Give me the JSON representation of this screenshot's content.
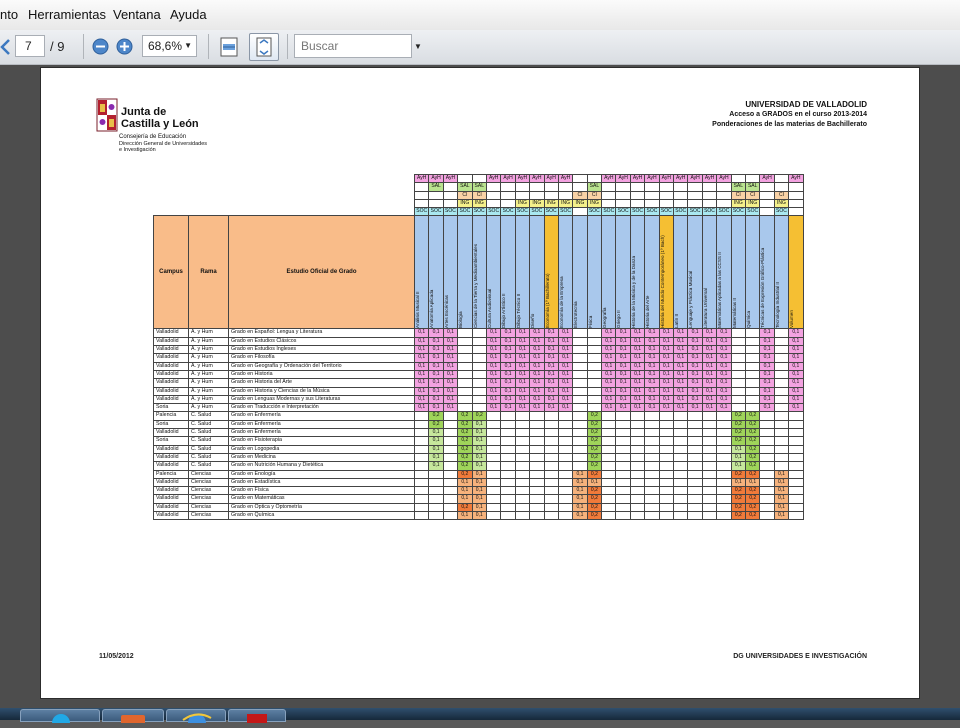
{
  "viewer": {
    "menu": [
      "nto",
      "Herramientas",
      "Ventana",
      "Ayuda"
    ],
    "current_page": "7",
    "total_pages": "/ 9",
    "zoom": "68,6%",
    "search_placeholder": "Buscar"
  },
  "doc": {
    "logo_line1": "Junta de",
    "logo_line2": "Castilla y León",
    "consejeria": "Consejería de Educación",
    "direccion1": "Dirección General de Universidades",
    "direccion2": "e Investigación",
    "university": "UNIVERSIDAD DE VALLADOLID",
    "subtitle": "Acceso a GRADOS en el curso 2013-2014",
    "subtitle2": "Ponderaciones de las materias de Bachillerato",
    "footer_date": "11/05/2012",
    "footer_dept": "DG UNIVERSIDADES E INVESTIGACIÓN"
  },
  "table": {
    "head_campus": "Campus",
    "head_rama": "Rama",
    "head_estudio": "Estudio Oficial de Grado",
    "subjects": [
      "Análisis Musical II",
      "Anatomía Aplicada",
      "Artes Escénicas",
      "Biología",
      "Ciencias de la Tierra y Medioambientales",
      "Cultura Audiovisual",
      "Dibujo Artístico II",
      "Dibujo Técnico II",
      "Diseño",
      "Economía (1º Bachillerato)",
      "Economía de la Empresa",
      "Electrotecnia",
      "Física",
      "Geografía",
      "Griego II",
      "Historia de la Música y de la Danza",
      "Historia del Arte",
      "Historia del Mundo Contemporáneo (1º Bach)",
      "Latín II",
      "Lenguaje y Práctica Musical",
      "Literatura Universal",
      "Matemáticas Aplicadas a las CCSS II",
      "Matemáticas II",
      "Química",
      "Técnicas de Expresión Gráfico-Plástica",
      "Tecnología Industrial II",
      "Volumen"
    ],
    "subject_colors": [
      "#a9c8ec",
      "#a9c8ec",
      "#a9c8ec",
      "#a9c8ec",
      "#a9c8ec",
      "#a9c8ec",
      "#a9c8ec",
      "#a9c8ec",
      "#a9c8ec",
      "#f5bf33",
      "#a9c8ec",
      "#a9c8ec",
      "#a9c8ec",
      "#a9c8ec",
      "#a9c8ec",
      "#a9c8ec",
      "#a9c8ec",
      "#f5bf33",
      "#a9c8ec",
      "#a9c8ec",
      "#a9c8ec",
      "#a9c8ec",
      "#a9c8ec",
      "#a9c8ec",
      "#a9c8ec",
      "#a9c8ec",
      "#f5bf33"
    ],
    "code_rows": [
      [
        "AyH",
        "AyH",
        "AyH",
        "",
        "",
        "AyH",
        "AyH",
        "AyH",
        "AyH",
        "AyH",
        "AyH",
        "",
        "",
        "AyH",
        "AyH",
        "AyH",
        "AyH",
        "AyH",
        "AyH",
        "AyH",
        "AyH",
        "AyH",
        "",
        "",
        "AyH",
        "",
        "AyH"
      ],
      [
        "",
        "SAL",
        "",
        "SAL",
        "SAL",
        "",
        "",
        "",
        "",
        "",
        "",
        "",
        "SAL",
        "",
        "",
        "",
        "",
        "",
        "",
        "",
        "",
        "",
        "SAL",
        "SAL",
        "",
        "",
        ""
      ],
      [
        "",
        "",
        "",
        "CI",
        "CI",
        "",
        "",
        "",
        "",
        "",
        "",
        "CI",
        "CI",
        "",
        "",
        "",
        "",
        "",
        "",
        "",
        "",
        "",
        "CI",
        "CI",
        "",
        "CI",
        ""
      ],
      [
        "",
        "",
        "",
        "ING",
        "ING",
        "",
        "",
        "ING",
        "ING",
        "ING",
        "ING",
        "ING",
        "ING",
        "",
        "",
        "",
        "",
        "",
        "",
        "",
        "",
        "",
        "ING",
        "ING",
        "",
        "ING",
        ""
      ],
      [
        "SOC",
        "SOC",
        "SOC",
        "SOC",
        "SOC",
        "SOC",
        "SOC",
        "SOC",
        "SOC",
        "SOC",
        "SOC",
        "",
        "SOC",
        "SOC",
        "SOC",
        "SOC",
        "SOC",
        "SOC",
        "SOC",
        "SOC",
        "SOC",
        "SOC",
        "SOC",
        "SOC",
        "",
        "SOC",
        ""
      ]
    ],
    "code_colors": {
      "AyH": "#f3a2e0",
      "SAL": "#b9e38f",
      "CI": "#f9d2a6",
      "ING": "#f4f08a",
      "SOC": "#a9e8f0"
    },
    "value_colors": {
      "pink": "#f3a2e0",
      "green": "#9fd45a",
      "orange": "#f07a3a",
      "plain": "#ffffff"
    },
    "rows": [
      {
        "campus": "Valladolid",
        "rama": "A. y Hum",
        "estudio": "Grado en Español: Lengua y Literatura",
        "v": [
          "0,1",
          "0,1",
          "0,1",
          "",
          "",
          "0,1",
          "0,1",
          "0,1",
          "0,1",
          "0,1",
          "0,1",
          "",
          "",
          "0,1",
          "0,1",
          "0,1",
          "0,1",
          "0,1",
          "0,1",
          "0,1",
          "0,1",
          "0,1",
          "",
          "",
          "0,1",
          "",
          "0,1"
        ],
        "c": "pink"
      },
      {
        "campus": "Valladolid",
        "rama": "A. y Hum",
        "estudio": "Grado en Estudios Clásicos",
        "v": [
          "0,1",
          "0,1",
          "0,1",
          "",
          "",
          "0,1",
          "0,1",
          "0,1",
          "0,1",
          "0,1",
          "0,1",
          "",
          "",
          "0,1",
          "0,1",
          "0,1",
          "0,1",
          "0,1",
          "0,1",
          "0,1",
          "0,1",
          "0,1",
          "",
          "",
          "0,1",
          "",
          "0,1"
        ],
        "c": "pink"
      },
      {
        "campus": "Valladolid",
        "rama": "A. y Hum",
        "estudio": "Grado en Estudios Ingleses",
        "v": [
          "0,1",
          "0,1",
          "0,1",
          "",
          "",
          "0,1",
          "0,1",
          "0,1",
          "0,1",
          "0,1",
          "0,1",
          "",
          "",
          "0,1",
          "0,1",
          "0,1",
          "0,1",
          "0,1",
          "0,1",
          "0,1",
          "0,1",
          "0,1",
          "",
          "",
          "0,1",
          "",
          "0,1"
        ],
        "c": "pink"
      },
      {
        "campus": "Valladolid",
        "rama": "A. y Hum",
        "estudio": "Grado en Filosofía",
        "v": [
          "0,1",
          "0,1",
          "0,1",
          "",
          "",
          "0,1",
          "0,1",
          "0,1",
          "0,1",
          "0,1",
          "0,1",
          "",
          "",
          "0,1",
          "0,1",
          "0,1",
          "0,1",
          "0,1",
          "0,1",
          "0,1",
          "0,1",
          "0,1",
          "",
          "",
          "0,1",
          "",
          "0,1"
        ],
        "c": "pink"
      },
      {
        "campus": "Valladolid",
        "rama": "A. y Hum",
        "estudio": "Grado en Geografía y Ordenación del Territorio",
        "v": [
          "0,1",
          "0,1",
          "0,1",
          "",
          "",
          "0,1",
          "0,1",
          "0,1",
          "0,1",
          "0,1",
          "0,1",
          "",
          "",
          "0,1",
          "0,1",
          "0,1",
          "0,1",
          "0,1",
          "0,1",
          "0,1",
          "0,1",
          "0,1",
          "",
          "",
          "0,1",
          "",
          "0,1"
        ],
        "c": "pink"
      },
      {
        "campus": "Valladolid",
        "rama": "A. y Hum",
        "estudio": "Grado en Historia",
        "v": [
          "0,1",
          "0,1",
          "0,1",
          "",
          "",
          "0,1",
          "0,1",
          "0,1",
          "0,1",
          "0,1",
          "0,1",
          "",
          "",
          "0,1",
          "0,1",
          "0,1",
          "0,1",
          "0,1",
          "0,1",
          "0,1",
          "0,1",
          "0,1",
          "",
          "",
          "0,1",
          "",
          "0,1"
        ],
        "c": "pink"
      },
      {
        "campus": "Valladolid",
        "rama": "A. y Hum",
        "estudio": "Grado en Historia del Arte",
        "v": [
          "0,1",
          "0,1",
          "0,1",
          "",
          "",
          "0,1",
          "0,1",
          "0,1",
          "0,1",
          "0,1",
          "0,1",
          "",
          "",
          "0,1",
          "0,1",
          "0,1",
          "0,1",
          "0,1",
          "0,1",
          "0,1",
          "0,1",
          "0,1",
          "",
          "",
          "0,1",
          "",
          "0,1"
        ],
        "c": "pink"
      },
      {
        "campus": "Valladolid",
        "rama": "A. y Hum",
        "estudio": "Grado en Historia y Ciencias de la Música",
        "v": [
          "0,1",
          "0,1",
          "0,1",
          "",
          "",
          "0,1",
          "0,1",
          "0,1",
          "0,1",
          "0,1",
          "0,1",
          "",
          "",
          "0,1",
          "0,1",
          "0,1",
          "0,1",
          "0,1",
          "0,1",
          "0,1",
          "0,1",
          "0,1",
          "",
          "",
          "0,1",
          "",
          "0,1"
        ],
        "c": "pink"
      },
      {
        "campus": "Valladolid",
        "rama": "A. y Hum",
        "estudio": "Grado en Lenguas Modernas y sus Literaturas",
        "v": [
          "0,1",
          "0,1",
          "0,1",
          "",
          "",
          "0,1",
          "0,1",
          "0,1",
          "0,1",
          "0,1",
          "0,1",
          "",
          "",
          "0,1",
          "0,1",
          "0,1",
          "0,1",
          "0,1",
          "0,1",
          "0,1",
          "0,1",
          "0,1",
          "",
          "",
          "0,1",
          "",
          "0,1"
        ],
        "c": "pink"
      },
      {
        "campus": "Soria",
        "rama": "A. y Hum",
        "estudio": "Grado en Traducción e Interpretación",
        "v": [
          "0,1",
          "0,1",
          "0,1",
          "",
          "",
          "0,1",
          "0,1",
          "0,1",
          "0,1",
          "0,1",
          "0,1",
          "",
          "",
          "0,1",
          "0,1",
          "0,1",
          "0,1",
          "0,1",
          "0,1",
          "0,1",
          "0,1",
          "0,1",
          "",
          "",
          "0,1",
          "",
          "0,1"
        ],
        "c": "pink"
      },
      {
        "campus": "Palencia",
        "rama": "C. Salud",
        "estudio": "Grado en Enfermería",
        "v": [
          "",
          "0,2",
          "",
          "0,2",
          "0,2",
          "",
          "",
          "",
          "",
          "",
          "",
          "",
          "0,2",
          "",
          "",
          "",
          "",
          "",
          "",
          "",
          "",
          "",
          "0,2",
          "0,2",
          "",
          "",
          ""
        ],
        "c": "green"
      },
      {
        "campus": "Soria",
        "rama": "C. Salud",
        "estudio": "Grado en Enfermería",
        "v": [
          "",
          "0,2",
          "",
          "0,2",
          "0,1",
          "",
          "",
          "",
          "",
          "",
          "",
          "",
          "0,2",
          "",
          "",
          "",
          "",
          "",
          "",
          "",
          "",
          "",
          "0,2",
          "0,2",
          "",
          "",
          ""
        ],
        "c": "green"
      },
      {
        "campus": "Valladolid",
        "rama": "C. Salud",
        "estudio": "Grado en Enfermería",
        "v": [
          "",
          "0,1",
          "",
          "0,2",
          "0,1",
          "",
          "",
          "",
          "",
          "",
          "",
          "",
          "0,2",
          "",
          "",
          "",
          "",
          "",
          "",
          "",
          "",
          "",
          "0,2",
          "0,2",
          "",
          "",
          ""
        ],
        "c": "green"
      },
      {
        "campus": "Soria",
        "rama": "C. Salud",
        "estudio": "Grado en Fisioterapia",
        "v": [
          "",
          "0,1",
          "",
          "0,2",
          "0,1",
          "",
          "",
          "",
          "",
          "",
          "",
          "",
          "0,2",
          "",
          "",
          "",
          "",
          "",
          "",
          "",
          "",
          "",
          "0,2",
          "0,2",
          "",
          "",
          ""
        ],
        "c": "green"
      },
      {
        "campus": "Valladolid",
        "rama": "C. Salud",
        "estudio": "Grado en Logopedia",
        "v": [
          "",
          "0,1",
          "",
          "0,2",
          "0,1",
          "",
          "",
          "",
          "",
          "",
          "",
          "",
          "0,2",
          "",
          "",
          "",
          "",
          "",
          "",
          "",
          "",
          "",
          "0,1",
          "0,2",
          "",
          "",
          ""
        ],
        "c": "green"
      },
      {
        "campus": "Valladolid",
        "rama": "C. Salud",
        "estudio": "Grado en Medicina",
        "v": [
          "",
          "0,1",
          "",
          "0,2",
          "0,1",
          "",
          "",
          "",
          "",
          "",
          "",
          "",
          "0,2",
          "",
          "",
          "",
          "",
          "",
          "",
          "",
          "",
          "",
          "0,1",
          "0,2",
          "",
          "",
          ""
        ],
        "c": "green"
      },
      {
        "campus": "Valladolid",
        "rama": "C. Salud",
        "estudio": "Grado en Nutrición Humana y Dietética",
        "v": [
          "",
          "0,1",
          "",
          "0,2",
          "0,1",
          "",
          "",
          "",
          "",
          "",
          "",
          "",
          "0,2",
          "",
          "",
          "",
          "",
          "",
          "",
          "",
          "",
          "",
          "0,1",
          "0,2",
          "",
          "",
          ""
        ],
        "c": "green"
      },
      {
        "campus": "Palencia",
        "rama": "Ciencias",
        "estudio": "Grado en Enología",
        "v": [
          "",
          "",
          "",
          "0,2",
          "0,1",
          "",
          "",
          "",
          "",
          "",
          "",
          "0,1",
          "0,2",
          "",
          "",
          "",
          "",
          "",
          "",
          "",
          "",
          "",
          "0,2",
          "0,2",
          "",
          "0,1",
          ""
        ],
        "c": "orange"
      },
      {
        "campus": "Valladolid",
        "rama": "Ciencias",
        "estudio": "Grado en Estadística",
        "v": [
          "",
          "",
          "",
          "0,1",
          "0,1",
          "",
          "",
          "",
          "",
          "",
          "",
          "0,1",
          "0,1",
          "",
          "",
          "",
          "",
          "",
          "",
          "",
          "",
          "",
          "0,1",
          "0,1",
          "",
          "0,1",
          ""
        ],
        "c": "orange"
      },
      {
        "campus": "Valladolid",
        "rama": "Ciencias",
        "estudio": "Grado en Física",
        "v": [
          "",
          "",
          "",
          "0,1",
          "0,1",
          "",
          "",
          "",
          "",
          "",
          "",
          "0,1",
          "0,2",
          "",
          "",
          "",
          "",
          "",
          "",
          "",
          "",
          "",
          "0,2",
          "0,2",
          "",
          "0,1",
          ""
        ],
        "c": "orange"
      },
      {
        "campus": "Valladolid",
        "rama": "Ciencias",
        "estudio": "Grado en Matemáticas",
        "v": [
          "",
          "",
          "",
          "0,1",
          "0,1",
          "",
          "",
          "",
          "",
          "",
          "",
          "0,1",
          "0,2",
          "",
          "",
          "",
          "",
          "",
          "",
          "",
          "",
          "",
          "0,2",
          "0,2",
          "",
          "0,1",
          ""
        ],
        "c": "orange"
      },
      {
        "campus": "Valladolid",
        "rama": "Ciencias",
        "estudio": "Grado en Óptica y Optometría",
        "v": [
          "",
          "",
          "",
          "0,2",
          "0,1",
          "",
          "",
          "",
          "",
          "",
          "",
          "0,1",
          "0,2",
          "",
          "",
          "",
          "",
          "",
          "",
          "",
          "",
          "",
          "0,2",
          "0,2",
          "",
          "0,1",
          ""
        ],
        "c": "orange"
      },
      {
        "campus": "Valladolid",
        "rama": "Ciencias",
        "estudio": "Grado en Química",
        "v": [
          "",
          "",
          "",
          "0,1",
          "0,1",
          "",
          "",
          "",
          "",
          "",
          "",
          "0,1",
          "0,2",
          "",
          "",
          "",
          "",
          "",
          "",
          "",
          "",
          "",
          "0,2",
          "0,2",
          "",
          "0,1",
          ""
        ],
        "c": "orange"
      }
    ]
  },
  "taskbar": {
    "items": [
      "skype-icon",
      "powerpoint-icon",
      "ie-icon",
      "acrobat-icon"
    ]
  }
}
